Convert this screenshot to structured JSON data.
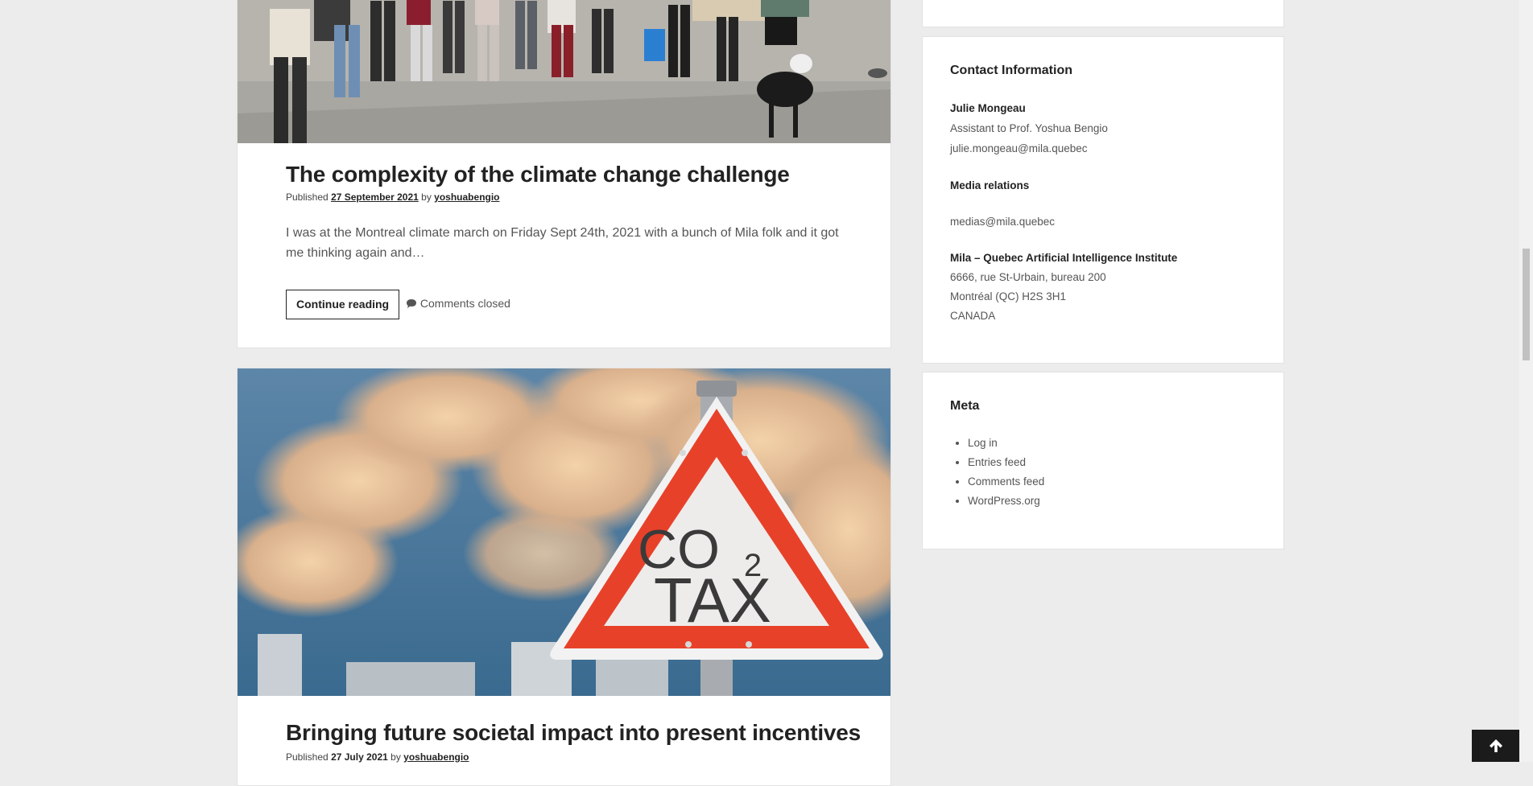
{
  "posts": [
    {
      "title": "The complexity of the climate change challenge",
      "published_label": "Published",
      "date": "27 September 2021",
      "by_label": "by",
      "author": "yoshuabengio",
      "excerpt": "I was at the Montreal climate march on Friday Sept 24th, 2021 with a bunch of Mila folk and it got me thinking again and…",
      "continue_label": "Continue reading",
      "comments_label": "Comments closed"
    },
    {
      "title": "Bringing future societal impact into present incentives",
      "published_label": "Published",
      "date": "27 July 2021",
      "by_label": "by",
      "author": "yoshuabengio",
      "sign_text_1": "CO",
      "sign_text_sub": "2",
      "sign_text_2": "TAX"
    }
  ],
  "sidebar": {
    "contact": {
      "title": "Contact Information",
      "name": "Julie Mongeau",
      "role": "Assistant to Prof. Yoshua Bengio",
      "email": "julie.mongeau@mila.quebec",
      "media_title": "Media relations",
      "media_email": "medias@mila.quebec",
      "org": "Mila – Quebec Artificial Intelligence Institute",
      "addr1": "6666, rue St-Urbain, bureau 200",
      "addr2": "Montréal (QC) H2S 3H1",
      "addr3": "CANADA"
    },
    "meta": {
      "title": "Meta",
      "items": [
        "Log in",
        "Entries feed",
        "Comments feed",
        "WordPress.org"
      ]
    }
  },
  "icons": {
    "comment": "comment-icon",
    "back_to_top": "arrow-up-icon"
  },
  "colors": {
    "sign_red": "#e8412a",
    "sky": "#3f6f94",
    "button_dark": "#1b1b1b"
  }
}
